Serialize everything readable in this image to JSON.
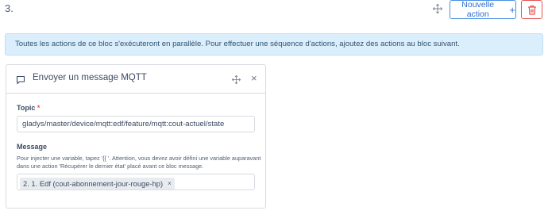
{
  "header": {
    "step_number": "3.",
    "new_action_label": "Nouvelle action",
    "new_action_icon": "+"
  },
  "alert": {
    "text": "Toutes les actions de ce bloc s'exécuteront en parallèle. Pour effectuer une séquence d'actions, ajoutez des actions au bloc suivant."
  },
  "card": {
    "title": "Envoyer un message MQTT",
    "close_icon": "×",
    "topic": {
      "label": "Topic",
      "required_mark": "*",
      "value": "gladys/master/device/mqtt:edf/feature/mqtt:cout-actuel/state"
    },
    "message": {
      "label": "Message",
      "help": "Pour injecter une variable, tapez '{{ '. Attention, vous devez avoir défini une variable auparavant dans une action 'Récupérer le dernier état' placé avant ce bloc message.",
      "tag_label": "2. 1. Edf (cout-abonnement-jour-rouge-hp)",
      "tag_remove": "×"
    }
  },
  "colors": {
    "primary": "#2e6fd1",
    "danger": "#e55353",
    "info_bg": "#dbeefc"
  }
}
